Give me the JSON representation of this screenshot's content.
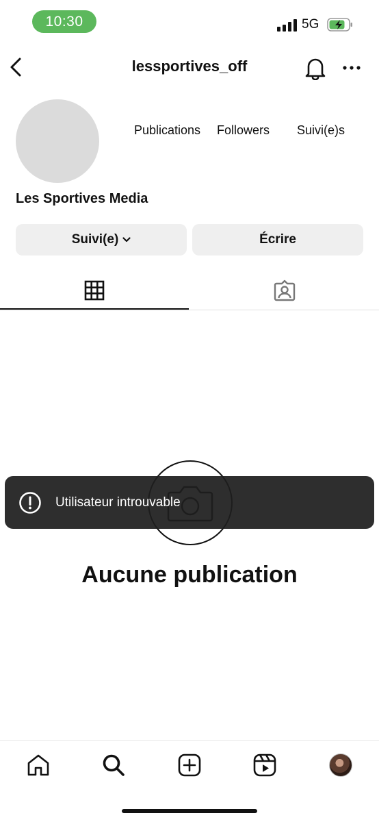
{
  "status_bar": {
    "time": "10:30",
    "network": "5G",
    "accent": "#5cb85c"
  },
  "header": {
    "username": "lessportives_off"
  },
  "profile": {
    "display_name": "Les Sportives Media",
    "stats": {
      "publications_label": "Publications",
      "followers_label": "Followers",
      "following_label": "Suivi(e)s"
    }
  },
  "actions": {
    "follow_label": "Suivi(e)",
    "message_label": "Écrire"
  },
  "tabs": [
    {
      "name": "grid",
      "icon": "grid-icon",
      "selected": true
    },
    {
      "name": "tagged",
      "icon": "tagged-person-icon",
      "selected": false
    }
  ],
  "empty_state": {
    "title": "Aucune publication",
    "icon": "camera-icon"
  },
  "toast": {
    "message": "Utilisateur introuvable",
    "icon": "exclamation-circle-icon"
  },
  "bottom_nav": [
    {
      "name": "home",
      "icon": "home-icon"
    },
    {
      "name": "search",
      "icon": "search-icon"
    },
    {
      "name": "create",
      "icon": "plus-square-icon"
    },
    {
      "name": "reels",
      "icon": "reels-icon"
    },
    {
      "name": "profile",
      "icon": "avatar"
    }
  ]
}
